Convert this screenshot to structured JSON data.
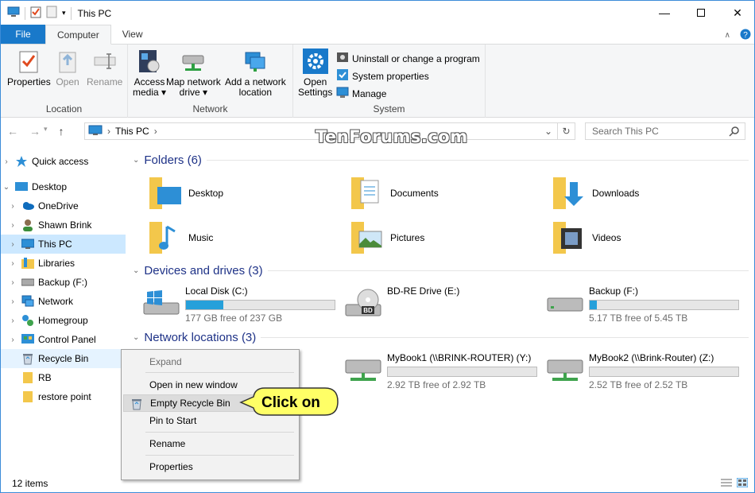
{
  "title": "This PC",
  "ribbon": {
    "tabs": {
      "file": "File",
      "computer": "Computer",
      "view": "View"
    },
    "location": {
      "label": "Location",
      "properties": "Properties",
      "open": "Open",
      "rename": "Rename"
    },
    "network": {
      "label": "Network",
      "access_media_1": "Access",
      "access_media_2": "media ▾",
      "map_drive_1": "Map network",
      "map_drive_2": "drive ▾",
      "add_loc_1": "Add a network",
      "add_loc_2": "location"
    },
    "system": {
      "label": "System",
      "open_settings_1": "Open",
      "open_settings_2": "Settings",
      "uninstall": "Uninstall or change a program",
      "sysprops": "System properties",
      "manage": "Manage"
    }
  },
  "address": {
    "path": "This PC",
    "search_placeholder": "Search This PC"
  },
  "watermark": "TenForums.com",
  "nav": {
    "quick_access": "Quick access",
    "desktop": "Desktop",
    "onedrive": "OneDrive",
    "shawn": "Shawn Brink",
    "thispc": "This PC",
    "libraries": "Libraries",
    "backup": "Backup (F:)",
    "network": "Network",
    "homegroup": "Homegroup",
    "control_panel": "Control Panel",
    "recycle_bin": "Recycle Bin",
    "rb": "RB",
    "restore_point": "restore point"
  },
  "sections": {
    "folders": "Folders (6)",
    "devices": "Devices and drives (3)",
    "netloc": "Network locations (3)"
  },
  "folders": [
    "Desktop",
    "Documents",
    "Downloads",
    "Music",
    "Pictures",
    "Videos"
  ],
  "drives": [
    {
      "name": "Local Disk (C:)",
      "free": "177 GB free of 237 GB",
      "used_fraction": 0.25
    },
    {
      "name": "BD-RE Drive (E:)",
      "free": "",
      "used_fraction": null
    },
    {
      "name": "Backup (F:)",
      "free": "5.17 TB free of 5.45 TB",
      "used_fraction": 0.05
    }
  ],
  "netlocs": [
    {
      "name": "MyBook1 (\\\\BRINK-ROUTER) (Y:)",
      "free": "2.92 TB free of 2.92 TB",
      "used_fraction": 0.0
    },
    {
      "name": "MyBook2 (\\\\Brink-Router) (Z:)",
      "free": "2.52 TB free of 2.52 TB",
      "used_fraction": 0.0
    }
  ],
  "status": {
    "items": "12 items"
  },
  "context_menu": {
    "expand": "Expand",
    "open_new": "Open in new window",
    "empty": "Empty Recycle Bin",
    "pin": "Pin to Start",
    "rename": "Rename",
    "properties": "Properties"
  },
  "callout": "Click on",
  "colors": {
    "accent": "#1979ca",
    "selected": "#cce8ff",
    "bar_fill": "#26a0da",
    "callout": "#ffff66"
  }
}
